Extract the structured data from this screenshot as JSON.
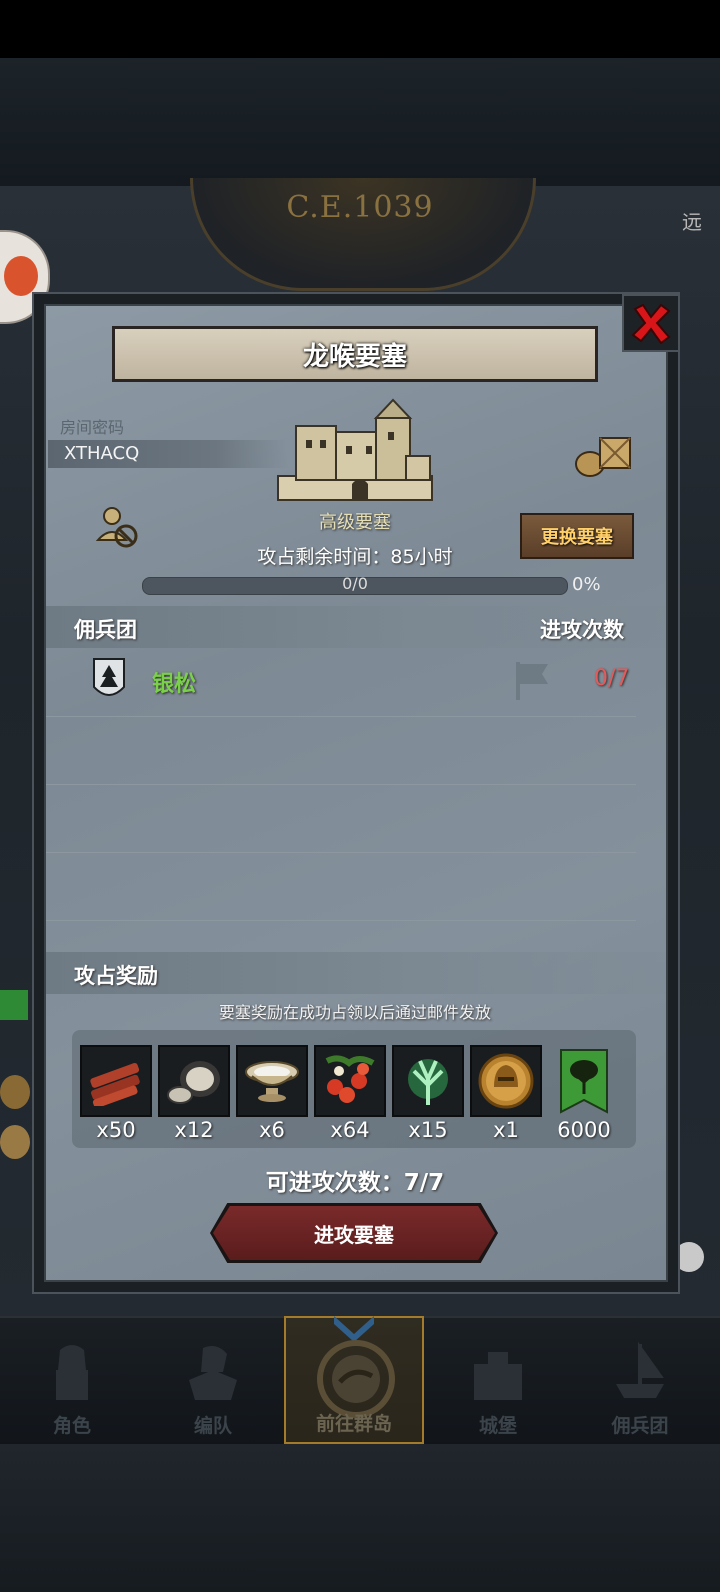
{
  "hud": {
    "era": "C.E.1039",
    "right_label": "远"
  },
  "dialog": {
    "title": "龙喉要塞",
    "room_code_label": "房间密码",
    "room_code": "XTHACQ",
    "fortress_type": "高级要塞",
    "time_label": "攻占剩余时间：85小时",
    "change_button": "更换要塞",
    "progress": {
      "text": "0/0",
      "percent_label": "0%",
      "fraction": 0
    },
    "mercenary_header": "佣兵团",
    "attack_count_header": "进攻次数",
    "mercenaries": [
      {
        "name": "银松",
        "attacks": "0/7"
      }
    ],
    "rewards_header": "攻占奖励",
    "rewards_note": "要塞奖励在成功占领以后通过邮件发放",
    "rewards": [
      {
        "icon": "wood-icon",
        "qty": "x50"
      },
      {
        "icon": "ore-icon",
        "qty": "x12"
      },
      {
        "icon": "bowl-icon",
        "qty": "x6"
      },
      {
        "icon": "berries-icon",
        "qty": "x64"
      },
      {
        "icon": "spirit-tree-icon",
        "qty": "x15"
      },
      {
        "icon": "helmet-coin-icon",
        "qty": "x1"
      },
      {
        "icon": "tree-banner-icon",
        "qty": "6000"
      }
    ],
    "attempts_label": "可进攻次数：7/7",
    "attack_button": "进攻要塞"
  },
  "nav": [
    {
      "label": "角色",
      "icon": "knight-icon"
    },
    {
      "label": "编队",
      "icon": "formation-icon"
    },
    {
      "label": "前往群岛",
      "icon": "compass-icon",
      "active": true
    },
    {
      "label": "城堡",
      "icon": "castle-icon"
    },
    {
      "label": "佣兵团",
      "icon": "ship-icon"
    }
  ],
  "colors": {
    "merc_name": "#7bd04a",
    "attack_count": "#e55a5a",
    "change_button_text": "#ffcf6a",
    "attack_button": "#6a2222",
    "nav_active_border": "#a37b2a"
  }
}
